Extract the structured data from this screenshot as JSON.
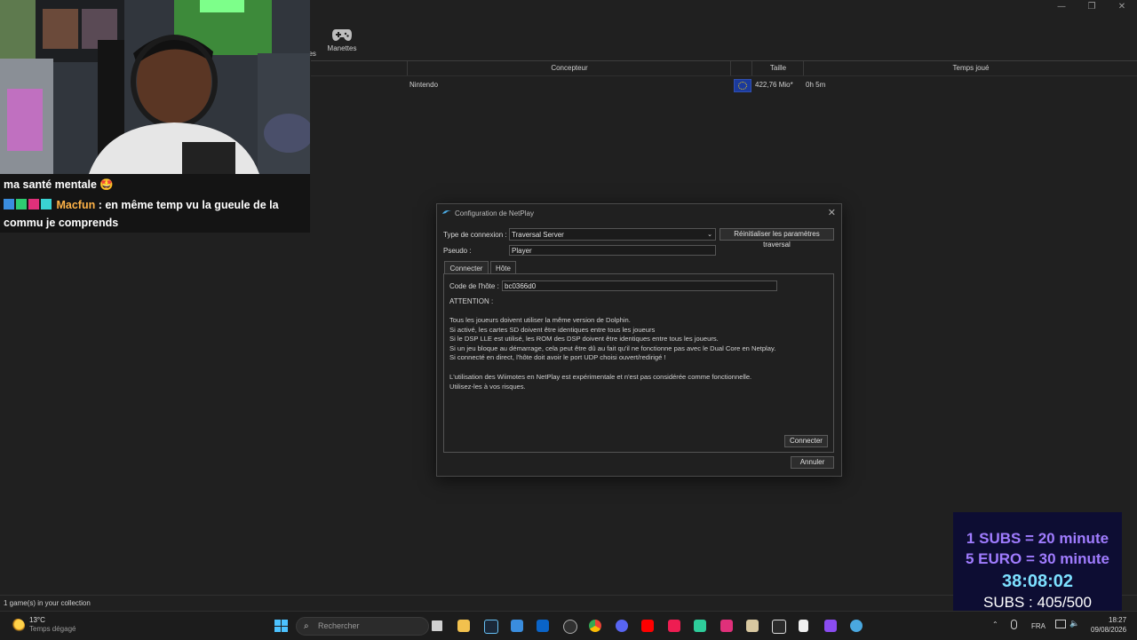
{
  "window": {
    "controls": [
      "—",
      "❐",
      "✕"
    ]
  },
  "toolbar": {
    "controllers_label": "Manettes",
    "cut_label": "nes"
  },
  "table": {
    "columns": [
      "Concepteur",
      "Taille",
      "Temps joué"
    ],
    "rows": [
      {
        "developer": "Nintendo",
        "size": "422,76 Mio*",
        "time_played": "0h 5m"
      }
    ]
  },
  "status_bar": {
    "text": "1 game(s) in your collection"
  },
  "overlay": {
    "chat": {
      "line1": "ma santé mentale 🤩",
      "line2_user": "Macfun",
      "line2_text": " : en même temp vu la gueule de la",
      "line3": "commu je comprends"
    },
    "subs": {
      "line1": "1 SUBS = 20 minute",
      "line2": "5 EURO = 30 minute",
      "timer": "38:08:02",
      "count": "SUBS : 405/500"
    }
  },
  "netplay": {
    "title": "Configuration de NetPlay",
    "connection_type_label": "Type de connexion :",
    "connection_type_value": "Traversal Server",
    "reset_button": "Réinitialiser les paramètres traversal",
    "nickname_label": "Pseudo :",
    "nickname_value": "Player",
    "tabs": [
      "Connecter",
      "Hôte"
    ],
    "host_code_label": "Code de l'hôte :",
    "host_code_value": "bc0366d0",
    "warning_title": "ATTENTION :",
    "warnings": [
      "Tous les joueurs doivent utiliser la même version de Dolphin.",
      "Si activé, les cartes SD doivent être identiques entre tous les joueurs",
      "Si le DSP LLE est utilisé, les ROM des DSP doivent être identiques entre tous les joueurs.",
      "Si un jeu bloque au démarrage, cela peut être dû au fait qu'il ne fonctionne pas avec le Dual Core en Netplay.",
      "Si connecté en direct, l'hôte doit avoir le port UDP choisi ouvert/redirigé !"
    ],
    "wiimote_note": [
      "L'utilisation des Wiimotes en NetPlay est expérimentale et n'est pas considérée comme fonctionnelle.",
      "Utilisez-les à vos risques."
    ],
    "connect_button": "Connecter",
    "cancel_button": "Annuler"
  },
  "taskbar": {
    "weather_temp": "13°C",
    "weather_desc": "Temps dégagé",
    "search_placeholder": "Rechercher",
    "language": "FRA",
    "time": "18:27",
    "date": "09/08/2026",
    "app_icons": [
      "windows-start",
      "search",
      "file-explorer",
      "folder",
      "steam",
      "store",
      "outlook",
      "obs",
      "chrome",
      "discord",
      "youtube",
      "tiktok",
      "app",
      "app",
      "app",
      "epic-games",
      "notepad",
      "app",
      "dolphin"
    ]
  },
  "colors": {
    "subs_line1": "#a07cff",
    "subs_line2": "#a07cff",
    "timer": "#7de0ff",
    "chat_user": "#ffb347"
  }
}
